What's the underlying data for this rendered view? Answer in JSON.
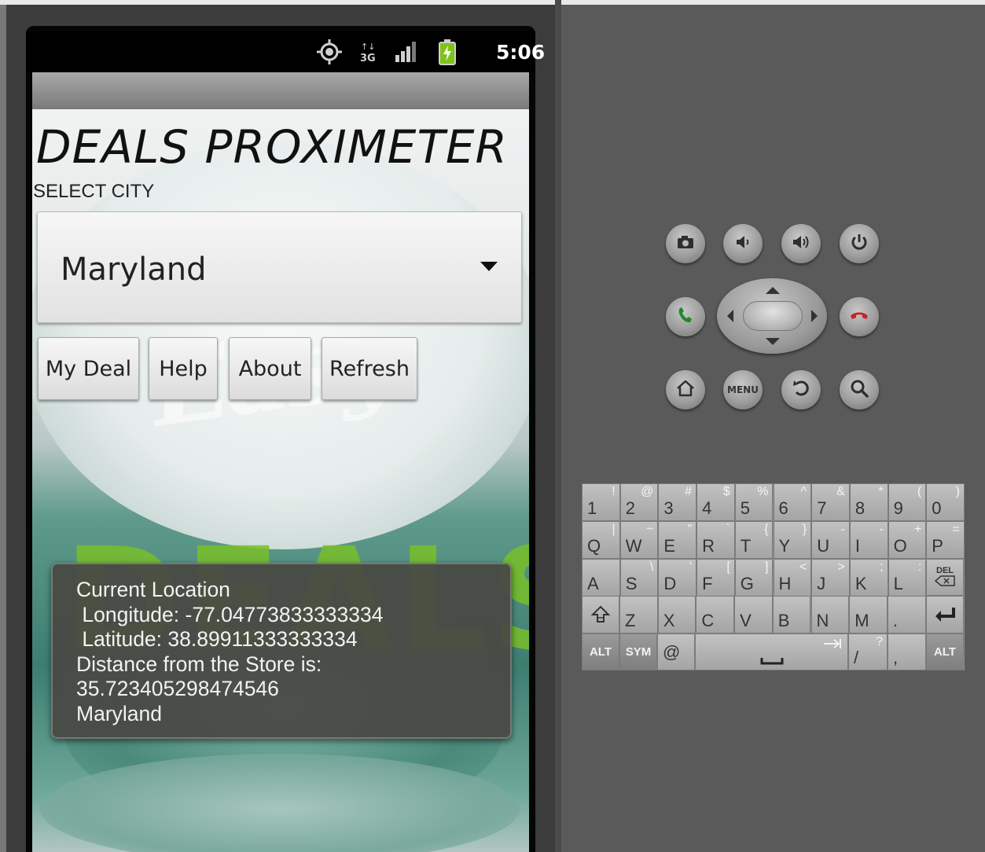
{
  "status_bar": {
    "time": "5:06",
    "icons": [
      "gps-icon",
      "network-3g-icon",
      "signal-icon",
      "battery-icon"
    ]
  },
  "app": {
    "title": "DEALS PROXIMETER",
    "select_label": "SELECT CITY",
    "city_spinner": {
      "selected": "Maryland"
    },
    "buttons": {
      "my_deal": "My Deal",
      "help": "Help",
      "about": "About",
      "refresh": "Refresh"
    },
    "toast": {
      "line1": "Current Location",
      "line2": " Longitude: -77.04773833333334",
      "line3": " Latitude: 38.89911333333334",
      "line4": "Distance from the Store is:",
      "line5": "35.723405298474546",
      "line6": "Maryland"
    },
    "background_art": {
      "watermark": "Easy",
      "logo": "DEALS"
    }
  },
  "controls": {
    "menu_label": "MENU",
    "icons": [
      "camera-icon",
      "volume-down-icon",
      "volume-up-icon",
      "power-icon",
      "call-icon",
      "end-call-icon",
      "home-icon",
      "back-icon",
      "search-icon"
    ]
  },
  "keyboard": {
    "row1": [
      {
        "main": "1",
        "alt": "!"
      },
      {
        "main": "2",
        "alt": "@"
      },
      {
        "main": "3",
        "alt": "#"
      },
      {
        "main": "4",
        "alt": "$"
      },
      {
        "main": "5",
        "alt": "%"
      },
      {
        "main": "6",
        "alt": "^"
      },
      {
        "main": "7",
        "alt": "&"
      },
      {
        "main": "8",
        "alt": "*"
      },
      {
        "main": "9",
        "alt": "("
      },
      {
        "main": "0",
        "alt": ")"
      }
    ],
    "row2": [
      {
        "main": "Q",
        "alt": "|"
      },
      {
        "main": "W",
        "alt": "~"
      },
      {
        "main": "E",
        "alt": "\""
      },
      {
        "main": "R",
        "alt": "`"
      },
      {
        "main": "T",
        "alt": "{"
      },
      {
        "main": "Y",
        "alt": "}"
      },
      {
        "main": "U",
        "alt": "-"
      },
      {
        "main": "I",
        "alt": "-"
      },
      {
        "main": "O",
        "alt": "+"
      },
      {
        "main": "P",
        "alt": "="
      }
    ],
    "row3": [
      {
        "main": "A",
        "alt": ""
      },
      {
        "main": "S",
        "alt": "\\"
      },
      {
        "main": "D",
        "alt": "'"
      },
      {
        "main": "F",
        "alt": "["
      },
      {
        "main": "G",
        "alt": "]"
      },
      {
        "main": "H",
        "alt": "<"
      },
      {
        "main": "J",
        "alt": ">"
      },
      {
        "main": "K",
        "alt": ";"
      },
      {
        "main": "L",
        "alt": ":"
      }
    ],
    "del_label": "DEL",
    "row4": [
      {
        "main": "Z",
        "alt": ""
      },
      {
        "main": "X",
        "alt": ""
      },
      {
        "main": "C",
        "alt": ""
      },
      {
        "main": "V",
        "alt": ""
      },
      {
        "main": "B",
        "alt": ""
      },
      {
        "main": "N",
        "alt": ""
      },
      {
        "main": "M",
        "alt": ""
      },
      {
        "main": ".",
        "alt": ""
      }
    ],
    "alt_label": "ALT",
    "sym_label": "SYM",
    "at_label": "@",
    "slash_label": "/",
    "question_label": "?",
    "comma_label": ","
  }
}
